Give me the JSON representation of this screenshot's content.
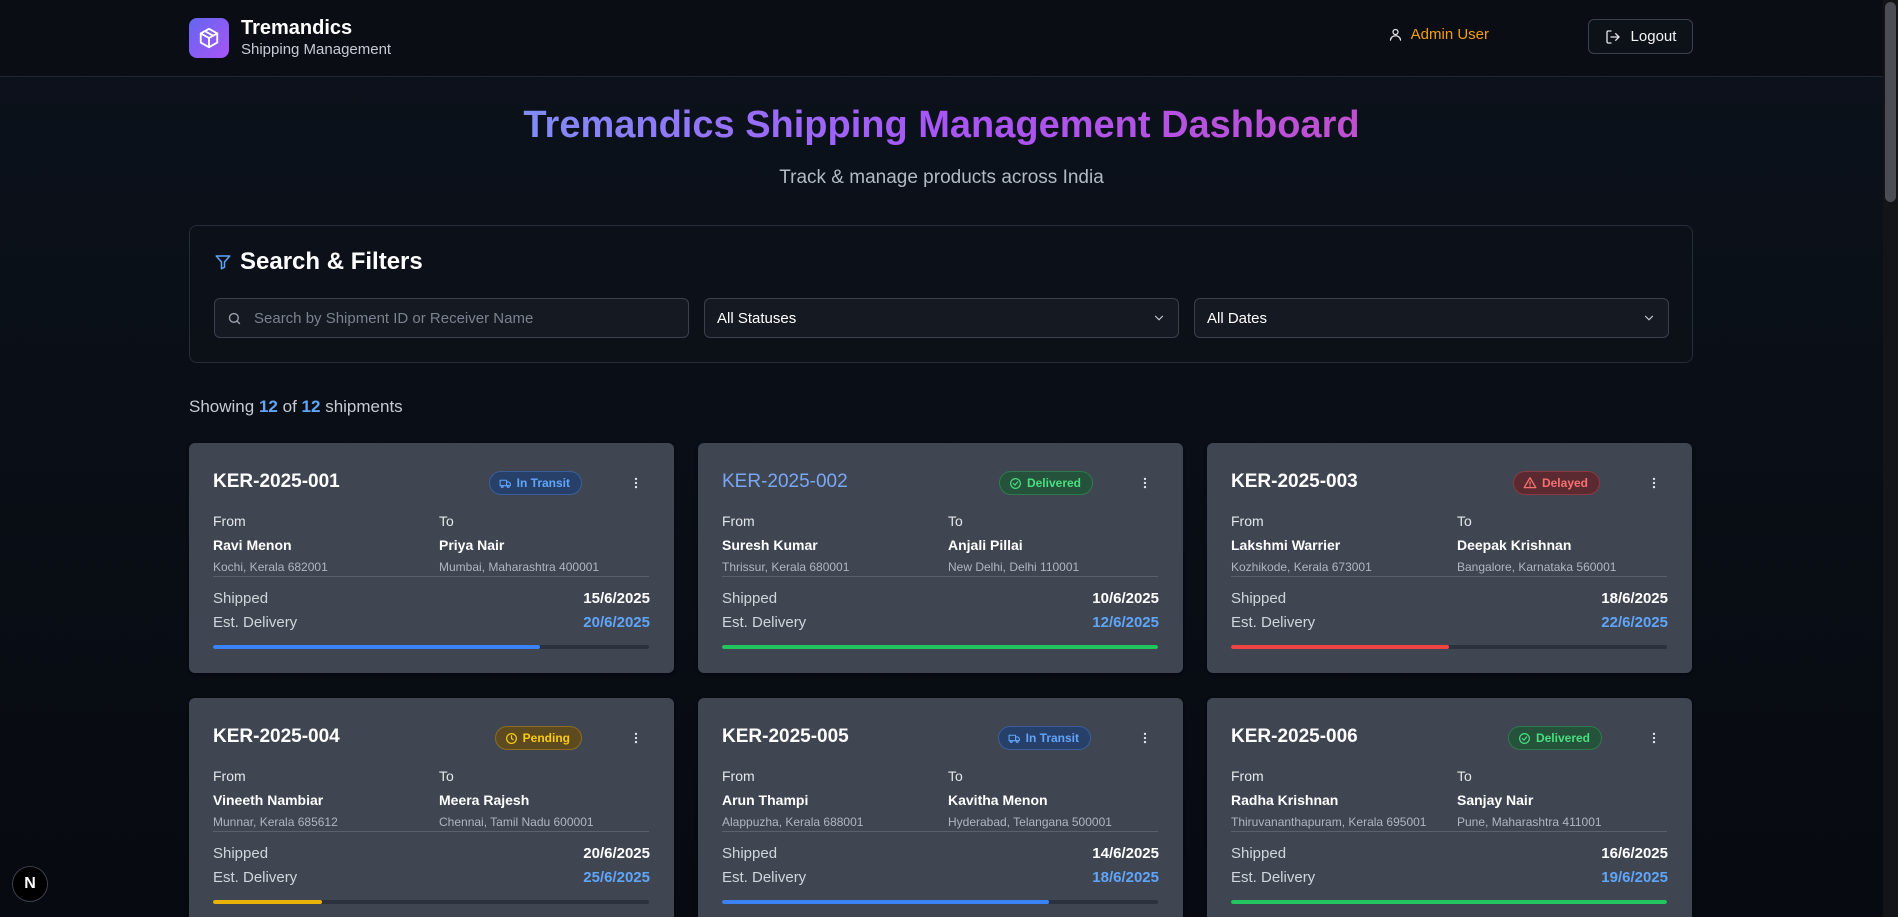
{
  "header": {
    "brand_title": "Tremandics",
    "brand_subtitle": "Shipping Management",
    "user_name": "Admin User",
    "logout_label": "Logout"
  },
  "hero": {
    "title": "Tremandics Shipping Management Dashboard",
    "subtitle": "Track & manage products across India"
  },
  "filters": {
    "heading": "Search & Filters",
    "search_placeholder": "Search by Shipment ID or Receiver Name",
    "status_value": "All Statuses",
    "date_value": "All Dates"
  },
  "summary": {
    "prefix": "Showing",
    "shown": "12",
    "of": "of",
    "total": "12",
    "suffix": "shipments"
  },
  "labels": {
    "from": "From",
    "to": "To",
    "shipped": "Shipped",
    "est_delivery": "Est. Delivery"
  },
  "colors": {
    "in_transit": "#3b82f6",
    "delivered": "#22c55e",
    "delayed": "#ef4444",
    "pending": "#eab308"
  },
  "shipments": [
    {
      "id": "KER-2025-001",
      "status": "In Transit",
      "status_key": "transit",
      "status_icon": "truck-icon",
      "progress": 0.75,
      "from_name": "Ravi Menon",
      "from_addr": "Kochi, Kerala 682001",
      "to_name": "Priya Nair",
      "to_addr": "Mumbai, Maharashtra 400001",
      "shipped": "15/6/2025",
      "est_delivery": "20/6/2025"
    },
    {
      "id": "KER-2025-002",
      "status": "Delivered",
      "status_key": "delivered",
      "status_icon": "check-circle-icon",
      "progress": 1.0,
      "from_name": "Suresh Kumar",
      "from_addr": "Thrissur, Kerala 680001",
      "to_name": "Anjali Pillai",
      "to_addr": "New Delhi, Delhi 110001",
      "shipped": "10/6/2025",
      "est_delivery": "12/6/2025"
    },
    {
      "id": "KER-2025-003",
      "status": "Delayed",
      "status_key": "delayed",
      "status_icon": "warning-icon",
      "progress": 0.5,
      "from_name": "Lakshmi Warrier",
      "from_addr": "Kozhikode, Kerala 673001",
      "to_name": "Deepak Krishnan",
      "to_addr": "Bangalore, Karnataka 560001",
      "shipped": "18/6/2025",
      "est_delivery": "22/6/2025"
    },
    {
      "id": "KER-2025-004",
      "status": "Pending",
      "status_key": "pending",
      "status_icon": "clock-icon",
      "progress": 0.25,
      "from_name": "Vineeth Nambiar",
      "from_addr": "Munnar, Kerala 685612",
      "to_name": "Meera Rajesh",
      "to_addr": "Chennai, Tamil Nadu 600001",
      "shipped": "20/6/2025",
      "est_delivery": "25/6/2025"
    },
    {
      "id": "KER-2025-005",
      "status": "In Transit",
      "status_key": "transit",
      "status_icon": "truck-icon",
      "progress": 0.75,
      "from_name": "Arun Thampi",
      "from_addr": "Alappuzha, Kerala 688001",
      "to_name": "Kavitha Menon",
      "to_addr": "Hyderabad, Telangana 500001",
      "shipped": "14/6/2025",
      "est_delivery": "18/6/2025"
    },
    {
      "id": "KER-2025-006",
      "status": "Delivered",
      "status_key": "delivered",
      "status_icon": "check-circle-icon",
      "progress": 1.0,
      "from_name": "Radha Krishnan",
      "from_addr": "Thiruvananthapuram, Kerala 695001",
      "to_name": "Sanjay Nair",
      "to_addr": "Pune, Maharashtra 411001",
      "shipped": "16/6/2025",
      "est_delivery": "19/6/2025"
    }
  ],
  "dev_indicator": "N"
}
